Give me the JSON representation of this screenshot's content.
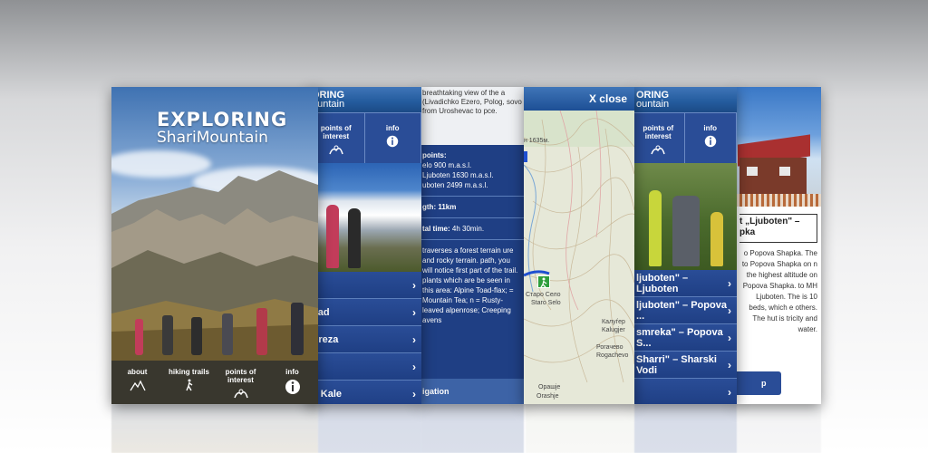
{
  "cover": {
    "title_line1": "EXPLORING",
    "title_line2": "ShariMountain",
    "nav": [
      {
        "label": "about",
        "icon": "mountain-icon"
      },
      {
        "label": "hiking trails",
        "icon": "hiker-icon"
      },
      {
        "label": "points of interest",
        "icon": "poi-icon"
      },
      {
        "label": "info",
        "icon": "info-icon"
      }
    ]
  },
  "menu_screen": {
    "brand_top": "ORING",
    "brand_bottom": "ountain",
    "tabs": [
      {
        "label": "points of interest"
      },
      {
        "label": "info"
      }
    ],
    "items": [
      {
        "label": ""
      },
      {
        "label": "pad"
      },
      {
        "label": "Ereza"
      },
      {
        "label": ""
      },
      {
        "label": "o Kale"
      }
    ]
  },
  "detail_screen": {
    "intro": "breathtaking view of the a (Livadichko Ezero, Polog, sovo from Uroshevac to pce.",
    "points_heading": "points:",
    "points": [
      "elo 900 m.a.s.l.",
      "Ljuboten 1630 m.a.s.l.",
      "uboten 2499 m.a.s.l."
    ],
    "length": "gth: 11km",
    "time_label": "tal time:",
    "time_value": "4h 30min.",
    "body": "traverses a forest terrain ure and rocky terrain. path, you will notice first part of the trail. plants which are be seen in this area: Alpine Toad-flax; = Mountain Tea; n = Rusty-leaved alpenrose; Creeping avens",
    "bottom_label": "igation"
  },
  "map_screen": {
    "close_label": "X close",
    "labels": {
      "elevation": "н 1635м.",
      "kalugjer_cyr": "Калуѓер",
      "kalugjer": "Kalugjer",
      "rogachevo_cyr": "Рогачево",
      "rogachevo": "Rogachevo",
      "staro_selo_cyr": "Старо Село",
      "staro_selo": "Staro Selo",
      "orashje_cyr": "Орашје",
      "orashje": "Orashje"
    }
  },
  "routes_screen": {
    "brand_top": "ORING",
    "brand_bottom": "ountain",
    "tabs": [
      {
        "label": "points of interest"
      },
      {
        "label": "info"
      }
    ],
    "items": [
      {
        "label": "ljuboten\" – Ljuboten"
      },
      {
        "label": "ljuboten\" – Popova ..."
      },
      {
        "label": "smreka\" – Popova S..."
      },
      {
        "label": "Sharri\" – Sharski Vodi"
      },
      {
        "label": ""
      }
    ]
  },
  "hut_screen": {
    "title": "t „Ljuboten\" – pka",
    "text": "o Popova Shapka. The to Popova Shapka on n the highest altitude on Popova Shapka. to MH Ljuboten. The is 10 beds, which e others. The hut is tricity and water.",
    "button_label": "p"
  }
}
